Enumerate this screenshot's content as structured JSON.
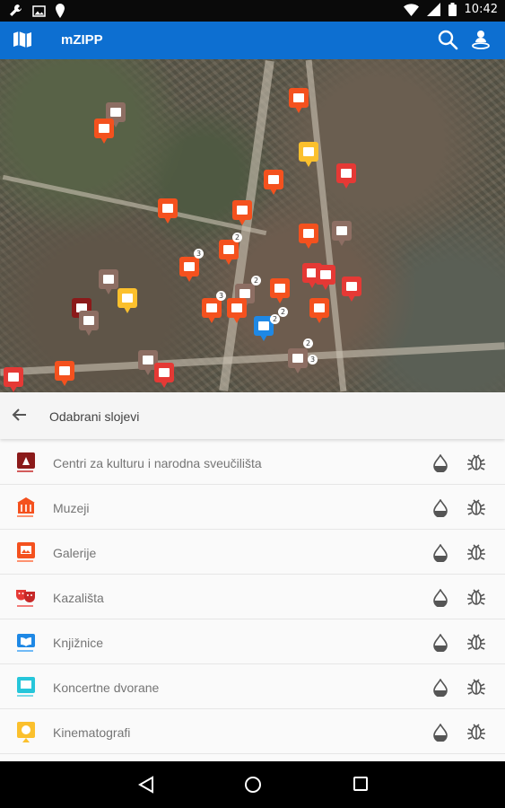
{
  "status_bar": {
    "time": "10:42",
    "left_icons": [
      "wrench-icon",
      "image-icon",
      "location-pin-icon"
    ],
    "right_icons": [
      "wifi-icon",
      "signal-icon",
      "battery-icon"
    ]
  },
  "appbar": {
    "title": "mZIPP",
    "icons": [
      "map-icon",
      "search-icon",
      "person-pin-icon"
    ]
  },
  "map": {
    "marker_types": [
      "gallery",
      "museum",
      "theatre",
      "library",
      "cinema",
      "cultural-centre"
    ],
    "cluster_counts": [
      "2",
      "3",
      "2",
      "3",
      "2",
      "2",
      "2",
      "3"
    ]
  },
  "panel": {
    "title": "Odabrani slojevi",
    "layers": [
      {
        "label": "Centri za kulturu i narodna sveučilišta",
        "color": "#8b1a1a",
        "icon": "cultural-centre-icon"
      },
      {
        "label": "Muzeji",
        "color": "#f4511e",
        "icon": "museum-icon"
      },
      {
        "label": "Galerije",
        "color": "#f4511e",
        "icon": "gallery-icon"
      },
      {
        "label": "Kazališta",
        "color": "#e53935",
        "icon": "theatre-masks-icon"
      },
      {
        "label": "Knjižnice",
        "color": "#1e88e5",
        "icon": "library-icon"
      },
      {
        "label": "Koncertne dvorane",
        "color": "#26c6da",
        "icon": "concert-hall-icon"
      },
      {
        "label": "Kinematografi",
        "color": "#fbc02d",
        "icon": "cinema-icon"
      }
    ]
  },
  "navbar": {
    "icons": [
      "back-triangle-icon",
      "home-circle-icon",
      "recents-square-icon"
    ]
  }
}
